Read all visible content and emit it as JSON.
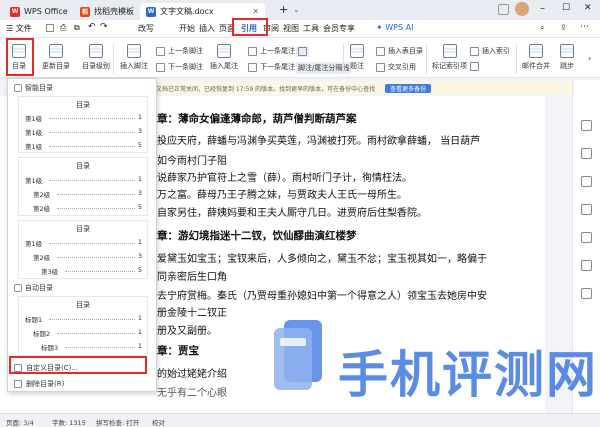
{
  "tabs": [
    {
      "label": "WPS Office"
    },
    {
      "label": "找稻壳模板"
    },
    {
      "label": "文字文稿.docx"
    }
  ],
  "menubar": {
    "file": "文件",
    "undo_label": "改写",
    "items": [
      "开始",
      "插入",
      "页面",
      "引用",
      "审阅",
      "视图",
      "工具",
      "会员专享"
    ],
    "ai": "WPS AI"
  },
  "ribbon": {
    "toc": "目录",
    "update_toc": "更新目录",
    "toc_level": "目录级别",
    "insert_footnote": "插入脚注",
    "prev_footnote": "上一条脚注",
    "next_footnote": "下一条脚注",
    "insert_endnote": "插入尾注",
    "prev_endnote": "上一条尾注",
    "next_endnote": "下一条尾注",
    "footnote_sep": "脚注/尾注分隔线",
    "caption": "题注",
    "insert_table_of_figures": "插入表目录",
    "cross_reference": "交叉引用",
    "mark_index": "标记索引项",
    "insert_index": "插入索引",
    "mail_merge": "邮件合并",
    "jump": "跳步"
  },
  "notice": {
    "text": "文档已正常关闭，已经恢复到 17:59 的版本。找到更早的版本，可在备份中心查找",
    "link": "查看更多备份"
  },
  "dropdown": {
    "sec1": "智能目录",
    "card1": {
      "title": "目录",
      "rows": [
        [
          "第1级",
          "1"
        ],
        [
          "第1级",
          "3"
        ],
        [
          "第1级",
          "5"
        ]
      ]
    },
    "card2": {
      "title": "目录",
      "rows": [
        [
          "第1级",
          "1"
        ],
        [
          "第2级",
          "3"
        ],
        [
          "第2级",
          "5"
        ]
      ]
    },
    "card3": {
      "title": "目录",
      "rows": [
        [
          "第1级",
          "1"
        ],
        [
          "第2级",
          "3"
        ],
        [
          "第3级",
          "5"
        ]
      ]
    },
    "sec2": "自动目录",
    "card4": {
      "title": "目录",
      "rows": [
        [
          "标题1",
          "1"
        ],
        [
          "标题2",
          "1"
        ],
        [
          "标题3",
          "1"
        ]
      ]
    },
    "custom": "自定义目录(C)...",
    "delete": "删除目录(R)"
  },
  "doc": {
    "lines": [
      "章：薄命女偏逢薄命郎，葫芦僧判断葫芦案",
      "投应天府，薛蟠与冯渊争买英莲，冯渊被打死。雨村欲拿薛蟠，  当日葫芦",
      "如今雨村门子阻",
      "  说薛家乃护官符上之雪（薛）。雨村听门子计，徇情枉法。",
      "万之富。薛母乃王子腾之妹，与贾政夫人王氏一母所生。",
      "自家另住，薛姨妈要和王夫人厮守几日。进贾府后住梨香院。",
      "章：游幻境指迷十二钗，饮仙醪曲演红楼梦",
      "爱黛玉如宝玉；宝钗来后，人多倾向之，黛玉不忿；宝玉视其如一，略偏于",
      "同亲密后生口角",
      "去宁府赏梅。秦氏（乃贾母重孙媳妇中第一个得意之人）领宝玉去她房中安",
      "册金陵十二钗正",
      "册及又副册。",
      "章：贾宝",
      "的始过姥姥介绍",
      "无乎有二个心眼"
    ]
  },
  "status": {
    "page": "页面: 3/4",
    "words": "字数: 1315",
    "spell": "拼写检查: 打开",
    "proof": "校对"
  },
  "watermark": {
    "text": "手机评测网"
  },
  "colors": {
    "accent": "#2b63d8",
    "highlight": "#e8282b",
    "watermark": "#4d82e3"
  }
}
